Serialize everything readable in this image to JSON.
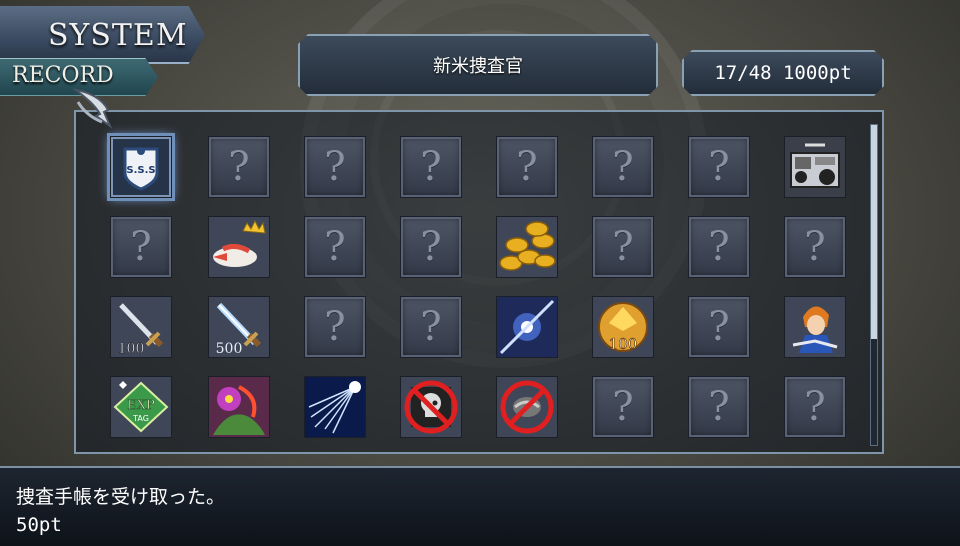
{
  "header": {
    "system_label": "SYSTEM",
    "record_label": "RECORD",
    "rank_title": "新米捜査官",
    "progress_text": "17/48 1000pt"
  },
  "progress": {
    "unlocked": 17,
    "total": 48,
    "points": 1000
  },
  "grid": {
    "columns": 8,
    "rows": [
      [
        {
          "id": "badge-sss",
          "type": "icon",
          "icon": "sss-badge-icon",
          "label": "S.S.S",
          "selected": true
        },
        {
          "type": "locked",
          "mark": "?"
        },
        {
          "type": "locked",
          "mark": "?"
        },
        {
          "type": "locked",
          "mark": "?"
        },
        {
          "type": "locked",
          "mark": "?"
        },
        {
          "type": "locked",
          "mark": "?"
        },
        {
          "type": "locked",
          "mark": "?"
        },
        {
          "id": "recorder",
          "type": "icon",
          "icon": "cassette-recorder-icon"
        }
      ],
      [
        {
          "type": "locked",
          "mark": "?"
        },
        {
          "id": "king-fish",
          "type": "icon",
          "icon": "crowned-fish-icon"
        },
        {
          "type": "locked",
          "mark": "?"
        },
        {
          "type": "locked",
          "mark": "?"
        },
        {
          "id": "gold-coins",
          "type": "icon",
          "icon": "gold-coins-icon"
        },
        {
          "type": "locked",
          "mark": "?"
        },
        {
          "type": "locked",
          "mark": "?"
        },
        {
          "type": "locked",
          "mark": "?"
        }
      ],
      [
        {
          "id": "sword-100",
          "type": "icon",
          "icon": "crossed-swords-icon",
          "label": "100"
        },
        {
          "id": "sword-500",
          "type": "icon",
          "icon": "glowing-sword-icon",
          "label": "500"
        },
        {
          "type": "locked",
          "mark": "?"
        },
        {
          "type": "locked",
          "mark": "?"
        },
        {
          "id": "light-slash",
          "type": "icon",
          "icon": "light-slash-icon"
        },
        {
          "id": "gem-100",
          "type": "icon",
          "icon": "gold-gem-icon",
          "label": "100"
        },
        {
          "type": "locked",
          "mark": "?"
        },
        {
          "id": "hero",
          "type": "icon",
          "icon": "hero-portrait-icon"
        }
      ],
      [
        {
          "id": "exp-tag",
          "type": "icon",
          "icon": "exp-tag-icon",
          "label": "EXP",
          "sublabel": "TAG"
        },
        {
          "id": "monster",
          "type": "icon",
          "icon": "monster-icon"
        },
        {
          "id": "blue-burst",
          "type": "icon",
          "icon": "blue-burst-icon"
        },
        {
          "id": "no-skull",
          "type": "icon",
          "icon": "no-skull-icon"
        },
        {
          "id": "no-item",
          "type": "icon",
          "icon": "no-item-icon"
        },
        {
          "type": "locked",
          "mark": "?"
        },
        {
          "type": "locked",
          "mark": "?"
        },
        {
          "type": "locked",
          "mark": "?"
        }
      ]
    ]
  },
  "scrollbar": {
    "position_fraction": 0.0,
    "visible_fraction": 0.67
  },
  "message": {
    "line1": "捜査手帳を受け取った。",
    "line2": "50pt"
  },
  "colors": {
    "accent": "#8fb6ff",
    "panel_border": "#7f95aa",
    "gold": "#e0b23a"
  }
}
